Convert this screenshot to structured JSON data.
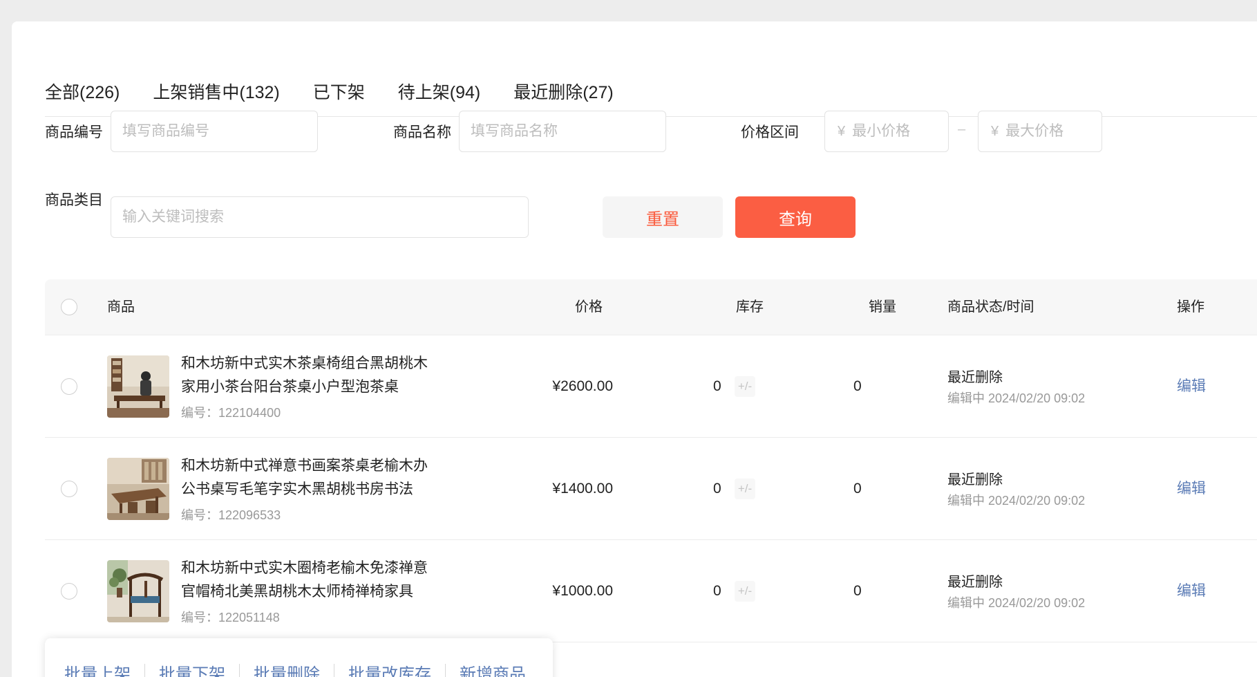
{
  "tabs": [
    {
      "label": "全部(226)"
    },
    {
      "label": "上架销售中(132)"
    },
    {
      "label": "已下架"
    },
    {
      "label": "待上架(94)"
    },
    {
      "label": "最近删除(27)"
    }
  ],
  "active_tab": 4,
  "filters": {
    "code_label": "商品编号",
    "code_placeholder": "填写商品编号",
    "name_label": "商品名称",
    "name_placeholder": "填写商品名称",
    "price_label": "价格区间",
    "currency": "¥",
    "min_placeholder": "最小价格",
    "max_placeholder": "最大价格",
    "range_sep": "–",
    "category_label": "商品类目",
    "category_placeholder": "输入关键词搜索",
    "reset_label": "重置",
    "query_label": "查询"
  },
  "table": {
    "headers": {
      "product": "商品",
      "price": "价格",
      "stock": "库存",
      "sales": "销量",
      "status": "商品状态/时间",
      "action": "操作"
    },
    "rows": [
      {
        "name": "和木坊新中式实木茶桌椅组合黑胡桃木家用小茶台阳台茶桌小户型泡茶桌",
        "code": "编号：122104400",
        "price": "¥2600.00",
        "stock": "0",
        "stock_edit": "+/-",
        "sales": "0",
        "status": "最近删除",
        "time": "编辑中 2024/02/20 09:02",
        "action": "编辑"
      },
      {
        "name": "和木坊新中式禅意书画案茶桌老榆木办公书桌写毛笔字实木黑胡桃书房书法",
        "code": "编号：122096533",
        "price": "¥1400.00",
        "stock": "0",
        "stock_edit": "+/-",
        "sales": "0",
        "status": "最近删除",
        "time": "编辑中 2024/02/20 09:02",
        "action": "编辑"
      },
      {
        "name": "和木坊新中式实木圈椅老榆木免漆禅意官帽椅北美黑胡桃木太师椅禅椅家具",
        "code": "编号：122051148",
        "price": "¥1000.00",
        "stock": "0",
        "stock_edit": "+/-",
        "sales": "0",
        "status": "最近删除",
        "time": "编辑中 2024/02/20 09:02",
        "action": "编辑"
      }
    ]
  },
  "batch_actions": [
    {
      "label": "批量上架"
    },
    {
      "label": "批量下架"
    },
    {
      "label": "批量删除"
    },
    {
      "label": "批量改库存"
    },
    {
      "label": "新增商品"
    }
  ],
  "colors": {
    "accent": "#fb5e43",
    "link": "#5a7bb5",
    "page_bg": "#ededed"
  }
}
